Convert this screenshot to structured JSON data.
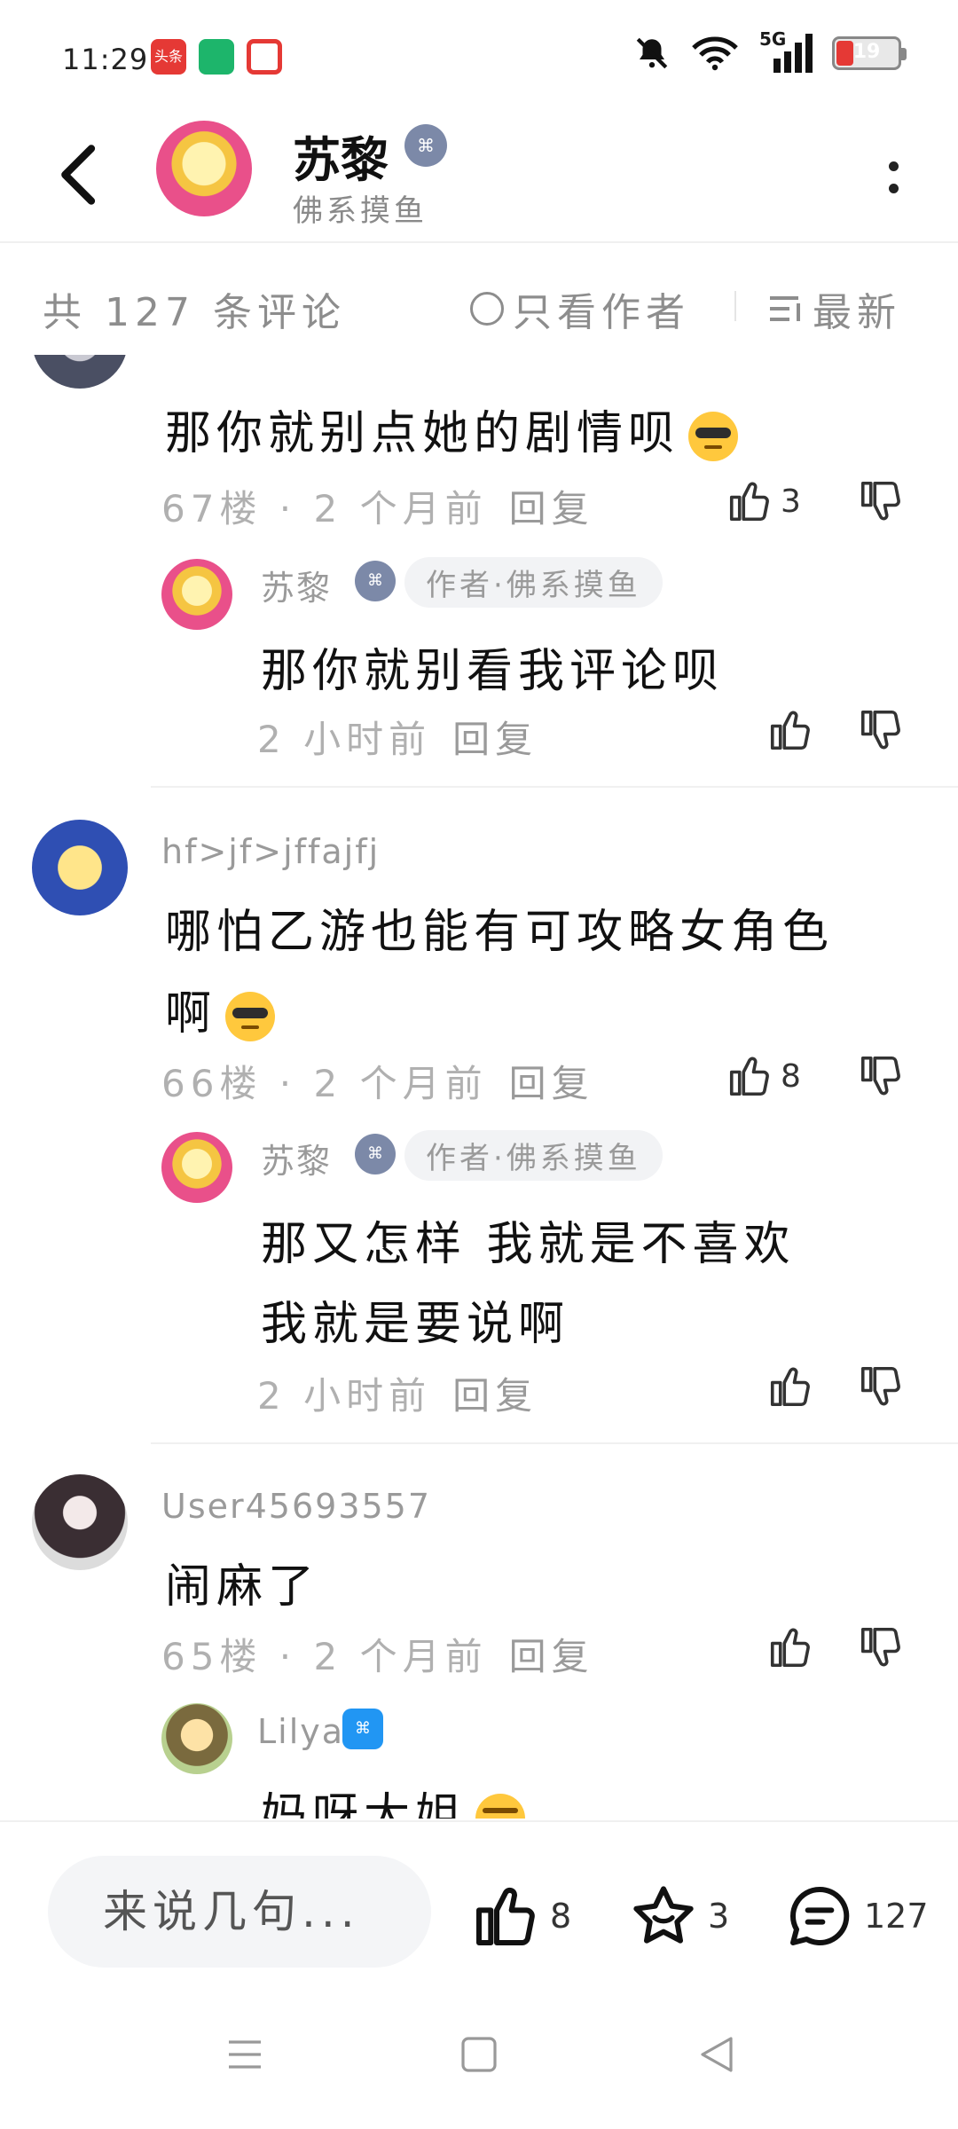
{
  "status_bar": {
    "time": "11:29",
    "network": "5G",
    "battery": "19",
    "apps": [
      {
        "name": "头条",
        "color": "#e53935"
      },
      {
        "name": "battery-app",
        "color": "#1db56b"
      },
      {
        "name": "video-app",
        "color": "#e53935"
      }
    ]
  },
  "header": {
    "name": "苏黎",
    "subtitle": "佛系摸鱼",
    "badge_icon": "gamepad-icon"
  },
  "filter": {
    "count_label": "共 127 条评论",
    "author_only_label": "只看作者",
    "sort_label": "最新"
  },
  "comments": [
    {
      "text": "那你就别点她的剧情呗",
      "floor": "67楼",
      "time": "2 个月前",
      "reply": "回复",
      "likes": "3",
      "replies": [
        {
          "user": "苏黎",
          "tag": "作者·佛系摸鱼",
          "text": "那你就别看我评论呗",
          "time": "2 小时前",
          "reply": "回复"
        }
      ]
    },
    {
      "user": "hf>jf>jffajfj",
      "text_line1": "哪怕乙游也能有可攻略女角色",
      "text_line2": "啊",
      "floor": "66楼",
      "time": "2 个月前",
      "reply": "回复",
      "likes": "8",
      "replies": [
        {
          "user": "苏黎",
          "tag": "作者·佛系摸鱼",
          "text_line1": "那又怎样 我就是不喜欢",
          "text_line2": "我就是要说啊",
          "time": "2 小时前",
          "reply": "回复"
        }
      ]
    },
    {
      "user": "User45693557",
      "text": "闹麻了",
      "floor": "65楼",
      "time": "2 个月前",
      "reply": "回复",
      "replies": [
        {
          "user": "Lilya",
          "text": "妈呀大姐"
        }
      ]
    }
  ],
  "bottom_bar": {
    "input_placeholder": "来说几句...",
    "likes": "8",
    "favorites": "3",
    "comments": "127"
  },
  "colors": {
    "muted": "#8d8d8d",
    "meta": "#b0b0b0",
    "badge": "#7c89a8",
    "badge_blue": "#2196f3"
  }
}
